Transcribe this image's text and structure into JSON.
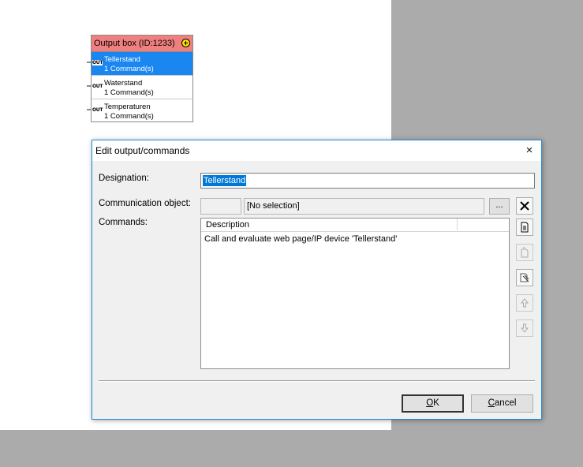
{
  "output_box": {
    "title": "Output box (ID:1233)",
    "rows": [
      {
        "tag": "OUT",
        "name": "Tellerstand",
        "commands": "1 Command(s)",
        "selected": true
      },
      {
        "tag": "OUT",
        "name": "Waterstand",
        "commands": "1 Command(s)",
        "selected": false
      },
      {
        "tag": "OUT",
        "name": "Temperaturen",
        "commands": "1 Command(s)",
        "selected": false
      }
    ]
  },
  "dialog": {
    "title": "Edit output/commands",
    "close_icon": "×",
    "designation_label": "Designation:",
    "designation_value": "Tellerstand",
    "comm_label": "Communication object:",
    "comm_value": "[No selection]",
    "browse_label": "...",
    "commands_label": "Commands:",
    "commands_columns": [
      "Description",
      ""
    ],
    "commands": [
      "Call and evaluate web page/IP device 'Tellerstand'"
    ],
    "ok_label": "OK",
    "ok_mnemonic": "O",
    "ok_rest": "K",
    "cancel_label": "Cancel",
    "cancel_mnemonic": "C",
    "cancel_rest": "ancel"
  },
  "colors": {
    "header_red": "#f08080",
    "selection_blue": "#1a86f0",
    "dialog_border": "#1c8cd9"
  }
}
